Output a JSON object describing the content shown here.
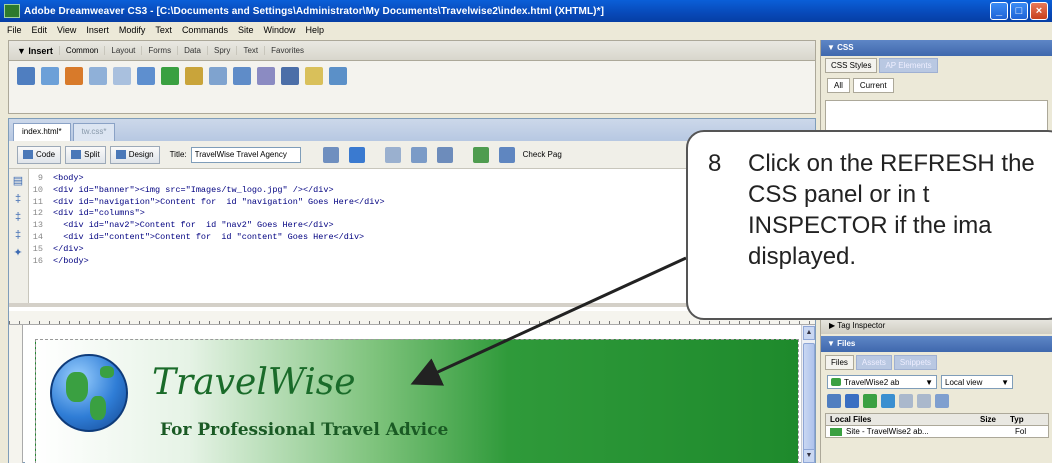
{
  "window": {
    "title": "Adobe Dreamweaver CS3 - [C:\\Documents and Settings\\Administrator\\My Documents\\Travelwise2\\index.html (XHTML)*]"
  },
  "menu": [
    "File",
    "Edit",
    "View",
    "Insert",
    "Modify",
    "Text",
    "Commands",
    "Site",
    "Window",
    "Help"
  ],
  "insert_panel": {
    "title": "▼ Insert",
    "tabs": [
      "Common",
      "Layout",
      "Forms",
      "Data",
      "Spry",
      "Text",
      "Favorites"
    ]
  },
  "document": {
    "tabs": [
      "index.html*",
      "tw.css*"
    ],
    "buttons": {
      "code": "Code",
      "split": "Split",
      "design": "Design"
    },
    "title_label": "Title:",
    "title_value": "TravelWise Travel Agency",
    "check_page": "Check Pag"
  },
  "code": [
    {
      "n": "9",
      "t": "<body>"
    },
    {
      "n": "10",
      "t": "<div id=\"banner\"><img src=\"Images/tw_logo.jpg\" /></div>"
    },
    {
      "n": "11",
      "t": "<div id=\"navigation\">Content for  id \"navigation\" Goes Here</div>"
    },
    {
      "n": "12",
      "t": "<div id=\"columns\">"
    },
    {
      "n": "13",
      "t": "  <div id=\"nav2\">Content for  id \"nav2\" Goes Here</div>"
    },
    {
      "n": "14",
      "t": "  <div id=\"content\">Content for  id \"content\" Goes Here</div>"
    },
    {
      "n": "15",
      "t": "</div>"
    },
    {
      "n": "16",
      "t": "</body>"
    }
  ],
  "banner": {
    "title": "TravelWise",
    "subtitle": "For Professional Travel Advice"
  },
  "css_panel": {
    "header": "▼ CSS",
    "tabs": [
      "CSS Styles",
      "AP Elements"
    ],
    "buttons": [
      "All",
      "Current"
    ]
  },
  "tag_inspector": "▶ Tag Inspector",
  "files_panel": {
    "header": "▼ Files",
    "tabs": [
      "Files",
      "Assets",
      "Snippets"
    ],
    "site": "TravelWise2 ab",
    "view": "Local view",
    "columns": [
      "Local Files",
      "Size",
      "Typ"
    ],
    "rows": [
      {
        "name": "Site - TravelWise2 ab...",
        "type": "Fol"
      }
    ]
  },
  "callout": {
    "number": "8",
    "text": "Click on the REFRESH the CSS panel or in t INSPECTOR if the ima displayed."
  },
  "colors": {
    "titlebar": "#0a5fd8",
    "banner_green": "#1e8a2c",
    "accent": "#3f68ad"
  }
}
